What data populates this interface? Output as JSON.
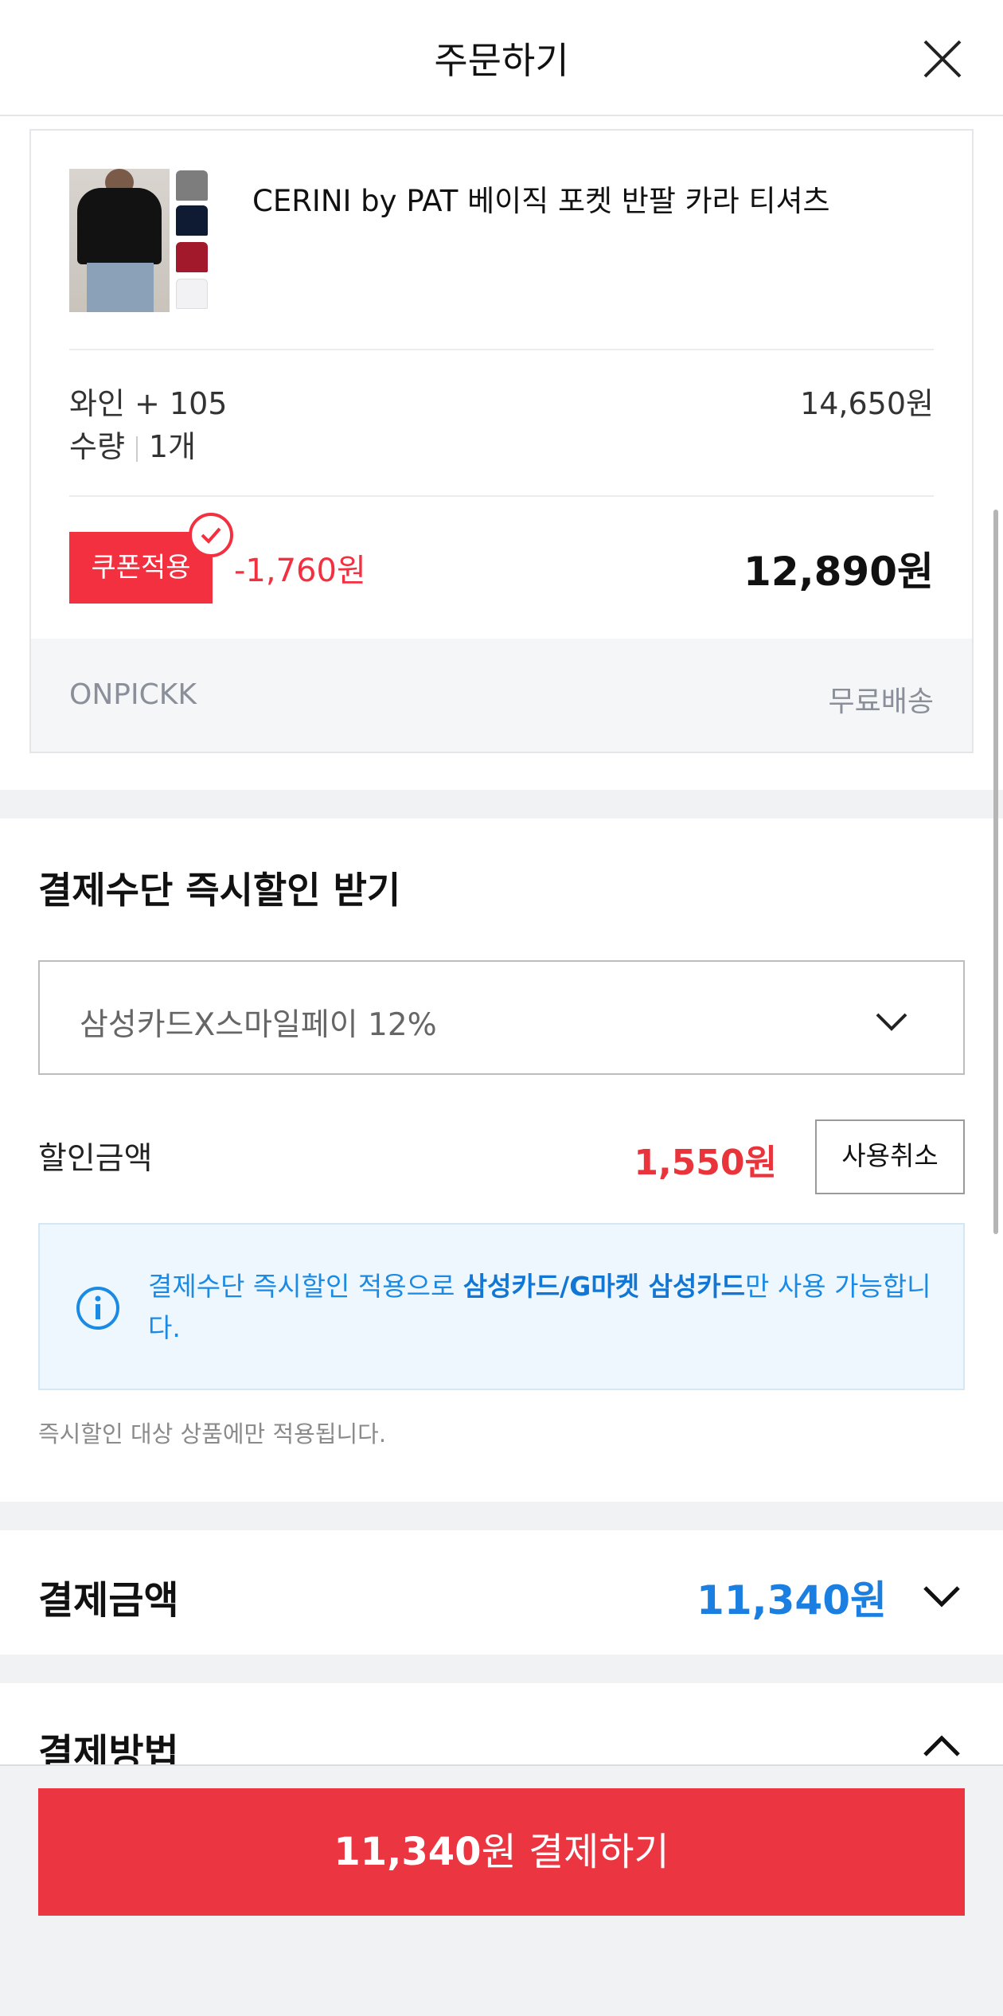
{
  "header": {
    "title": "주문하기",
    "close_icon": "close-icon"
  },
  "product": {
    "name": "CERINI by PAT 베이직 포켓 반팔 카라 티셔츠",
    "option": "와인 + 105",
    "quantity_label": "수량",
    "quantity_value": "1개",
    "option_price": "14,650원",
    "coupon_label": "쿠폰적용",
    "coupon_discount": "-1,760원",
    "final_price": "12,890원",
    "seller": "ONPICKK",
    "shipping": "무료배송",
    "swatch_colors": [
      "#7d7d7d",
      "#0f1a33",
      "#a3192c",
      "#f2f2f4"
    ]
  },
  "instant_discount": {
    "title": "결제수단 즉시할인 받기",
    "selected_option": "삼성카드X스마일페이 12%",
    "discount_label": "할인금액",
    "discount_amount": "1,550원",
    "cancel_label": "사용취소",
    "info_text_pre": "결제수단 즉시할인 적용으로 ",
    "info_text_bold": "삼성카드/G마켓 삼성카드",
    "info_text_post": "만 사용 가능합니다.",
    "note": "즉시할인 대상 상품에만 적용됩니다."
  },
  "payment_amount": {
    "title": "결제금액",
    "value": "11,340원"
  },
  "payment_method": {
    "title": "결제방법"
  },
  "pay_button": {
    "amount": "11,340",
    "suffix": "원 결제하기"
  },
  "colors": {
    "accent_red": "#eb3541",
    "accent_blue": "#1a7fe0",
    "info_bg": "#eef7fd"
  }
}
